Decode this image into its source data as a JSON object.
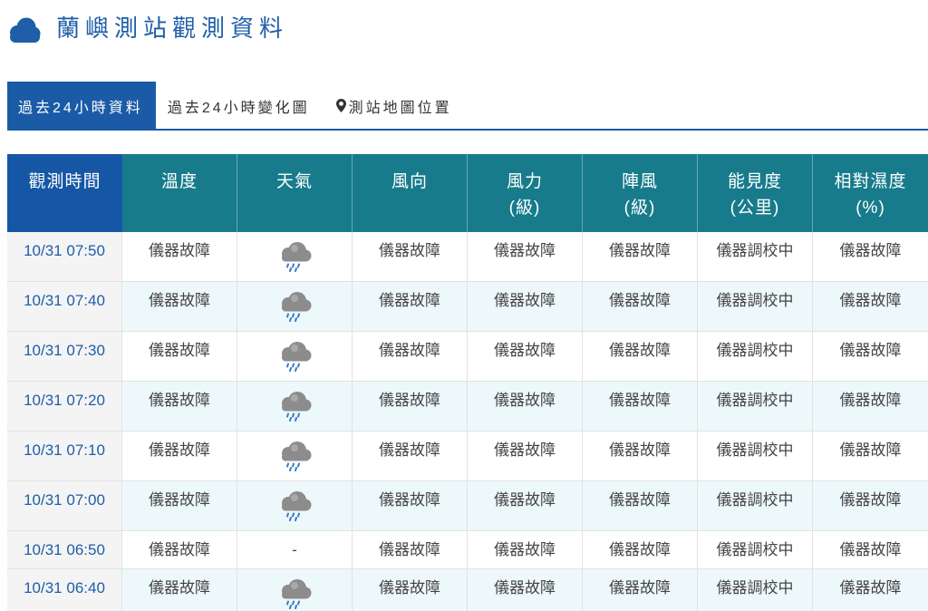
{
  "page": {
    "title": "蘭嶼測站觀測資料",
    "logo_icon": "cloud-icon"
  },
  "tabs": [
    {
      "label": "過去24小時資料",
      "active": true
    },
    {
      "label": "過去24小時變化圖",
      "active": false
    },
    {
      "label": "測站地圖位置",
      "icon": "map-marker-icon",
      "active": false
    }
  ],
  "table": {
    "columns": [
      {
        "label": "觀測時間"
      },
      {
        "label": "溫度"
      },
      {
        "label": "天氣"
      },
      {
        "label": "風向"
      },
      {
        "label": "風力",
        "unit": "(級)"
      },
      {
        "label": "陣風",
        "unit": "(級)"
      },
      {
        "label": "能見度",
        "unit": "(公里)"
      },
      {
        "label": "相對濕度",
        "unit": "(%)"
      }
    ],
    "rows": [
      {
        "time": "10/31 07:50",
        "temperature": "儀器故障",
        "weather_icon": "rain-cloud-icon",
        "wind_direction": "儀器故障",
        "wind_force": "儀器故障",
        "gust": "儀器故障",
        "visibility": "儀器調校中",
        "humidity": "儀器故障"
      },
      {
        "time": "10/31 07:40",
        "temperature": "儀器故障",
        "weather_icon": "rain-cloud-icon",
        "wind_direction": "儀器故障",
        "wind_force": "儀器故障",
        "gust": "儀器故障",
        "visibility": "儀器調校中",
        "humidity": "儀器故障"
      },
      {
        "time": "10/31 07:30",
        "temperature": "儀器故障",
        "weather_icon": "rain-cloud-icon",
        "wind_direction": "儀器故障",
        "wind_force": "儀器故障",
        "gust": "儀器故障",
        "visibility": "儀器調校中",
        "humidity": "儀器故障"
      },
      {
        "time": "10/31 07:20",
        "temperature": "儀器故障",
        "weather_icon": "rain-cloud-icon",
        "wind_direction": "儀器故障",
        "wind_force": "儀器故障",
        "gust": "儀器故障",
        "visibility": "儀器調校中",
        "humidity": "儀器故障"
      },
      {
        "time": "10/31 07:10",
        "temperature": "儀器故障",
        "weather_icon": "rain-cloud-icon",
        "wind_direction": "儀器故障",
        "wind_force": "儀器故障",
        "gust": "儀器故障",
        "visibility": "儀器調校中",
        "humidity": "儀器故障"
      },
      {
        "time": "10/31 07:00",
        "temperature": "儀器故障",
        "weather_icon": "rain-cloud-icon",
        "wind_direction": "儀器故障",
        "wind_force": "儀器故障",
        "gust": "儀器故障",
        "visibility": "儀器調校中",
        "humidity": "儀器故障"
      },
      {
        "time": "10/31 06:50",
        "temperature": "儀器故障",
        "weather_text": "-",
        "wind_direction": "儀器故障",
        "wind_force": "儀器故障",
        "gust": "儀器故障",
        "visibility": "儀器調校中",
        "humidity": "儀器故障"
      },
      {
        "time": "10/31 06:40",
        "temperature": "儀器故障",
        "weather_icon": "rain-cloud-icon",
        "wind_direction": "儀器故障",
        "wind_force": "儀器故障",
        "gust": "儀器故障",
        "visibility": "儀器調校中",
        "humidity": "儀器故障"
      }
    ]
  },
  "colors": {
    "title": "#1f5ea8",
    "active_tab": "#1b5aa6",
    "header_time_bg": "#1657a5",
    "header_bg": "#177b8b",
    "time_text": "#1f5ea8",
    "alt_row_bg": "#edf8fb",
    "rain_cloud": "#8c8c8c",
    "rain_drop": "#3a7cc0"
  }
}
